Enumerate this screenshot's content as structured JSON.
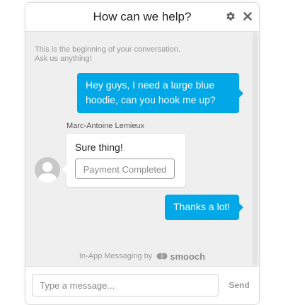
{
  "header": {
    "title": "How can we help?",
    "settings_icon": "gear-icon",
    "close_icon": "close-icon"
  },
  "conversation": {
    "intro_line1": "This is the beginning of your conversation.",
    "intro_line2": "Ask us anything!",
    "messages": [
      {
        "from": "user",
        "text": "Hey guys, I need a large blue hoodie, can you hook me up?"
      },
      {
        "from": "agent",
        "sender": "Marc-Antoine Lemieux",
        "text": "Sure thing!",
        "action_label": "Payment Completed"
      },
      {
        "from": "user",
        "text": "Thanks a lot!"
      }
    ]
  },
  "footer": {
    "powered_by": "In-App Messaging by",
    "brand": "smooch"
  },
  "composer": {
    "placeholder": "Type a message...",
    "value": "",
    "send_label": "Send"
  },
  "colors": {
    "accent": "#00a8e8",
    "background": "#efefef",
    "agent_bubble": "#ffffff"
  }
}
